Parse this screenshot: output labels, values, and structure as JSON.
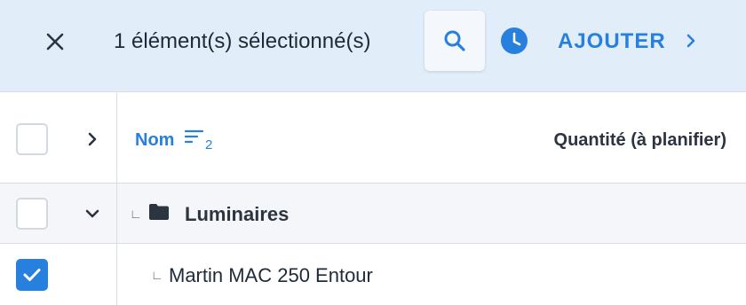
{
  "toolbar": {
    "selection_text": "1 élément(s) sélectionné(s)",
    "add_label": "AJOUTER",
    "accent_color": "#2880de",
    "icons": [
      "close-icon",
      "search-icon",
      "clock-icon",
      "chevron-right-icon"
    ]
  },
  "table": {
    "columns": {
      "name": "Nom",
      "name_sort_index": "2",
      "quantity": "Quantité (à planifier)"
    },
    "group": {
      "label": "Luminaires",
      "checked": false,
      "expanded": true
    },
    "items": [
      {
        "label": "Martin MAC 250 Entour",
        "checked": true
      }
    ],
    "tree_marker": "∟"
  }
}
